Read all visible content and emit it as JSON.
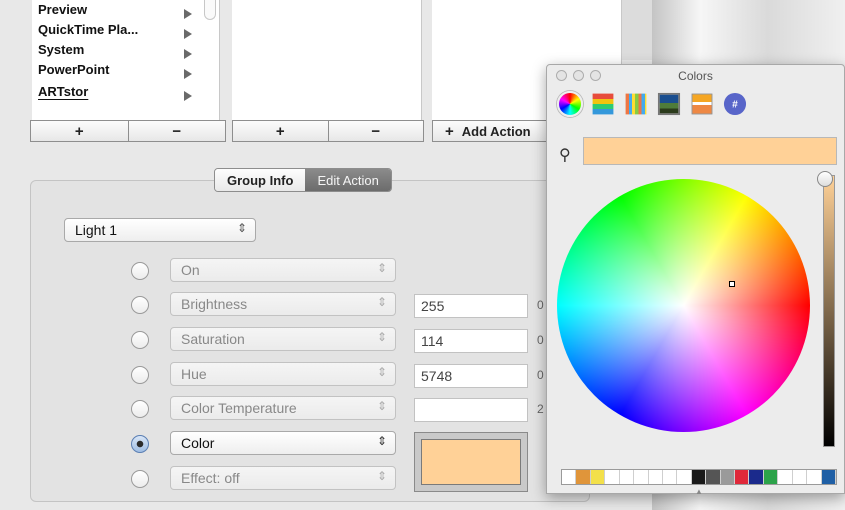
{
  "lists": {
    "col1_items": [
      {
        "label": "Preview"
      },
      {
        "label": "QuickTime Pla..."
      },
      {
        "label": "System"
      },
      {
        "label": "PowerPoint"
      },
      {
        "label": "ARTstor"
      }
    ]
  },
  "button_bars": {
    "plus": "+",
    "minus": "−",
    "add_action": "Add Action",
    "add_plus": "+"
  },
  "tabs": {
    "group_info": "Group Info",
    "edit_action": "Edit Action",
    "selected": "Edit Action"
  },
  "light_select": {
    "value": "Light 1"
  },
  "properties": [
    {
      "label": "On",
      "enabled": false,
      "selected": false,
      "value": ""
    },
    {
      "label": "Brightness",
      "enabled": false,
      "selected": false,
      "value": "255",
      "suffix": "0"
    },
    {
      "label": "Saturation",
      "enabled": false,
      "selected": false,
      "value": "114",
      "suffix": "0"
    },
    {
      "label": "Hue",
      "enabled": false,
      "selected": false,
      "value": "5748",
      "suffix": "0"
    },
    {
      "label": "Color Temperature",
      "enabled": false,
      "selected": false,
      "value": "",
      "suffix": "2"
    },
    {
      "label": "Color",
      "enabled": true,
      "selected": true
    },
    {
      "label": "Effect: off",
      "enabled": false,
      "selected": false
    }
  ],
  "stepper_glyph": "⇕",
  "current_color": "#ffd197",
  "colors_panel": {
    "title": "Colors",
    "modes": [
      "color-wheel",
      "color-sliders",
      "color-palettes",
      "image-palettes",
      "crayons",
      "hex"
    ],
    "hex_glyph": "#",
    "search_glyph": "🔍",
    "selected_color": "#ffd197",
    "swatches": [
      "#ffffff",
      "#e0953a",
      "#f3e04a",
      "#ffffff",
      "#ffffff",
      "#ffffff",
      "#ffffff",
      "#ffffff",
      "#ffffff",
      "#1a1a1a",
      "#555555",
      "#9a9a9a",
      "#e0283a",
      "#1b2a8c",
      "#2ca34a",
      "#ffffff",
      "#ffffff",
      "#ffffff",
      "#1f5fa5"
    ]
  }
}
